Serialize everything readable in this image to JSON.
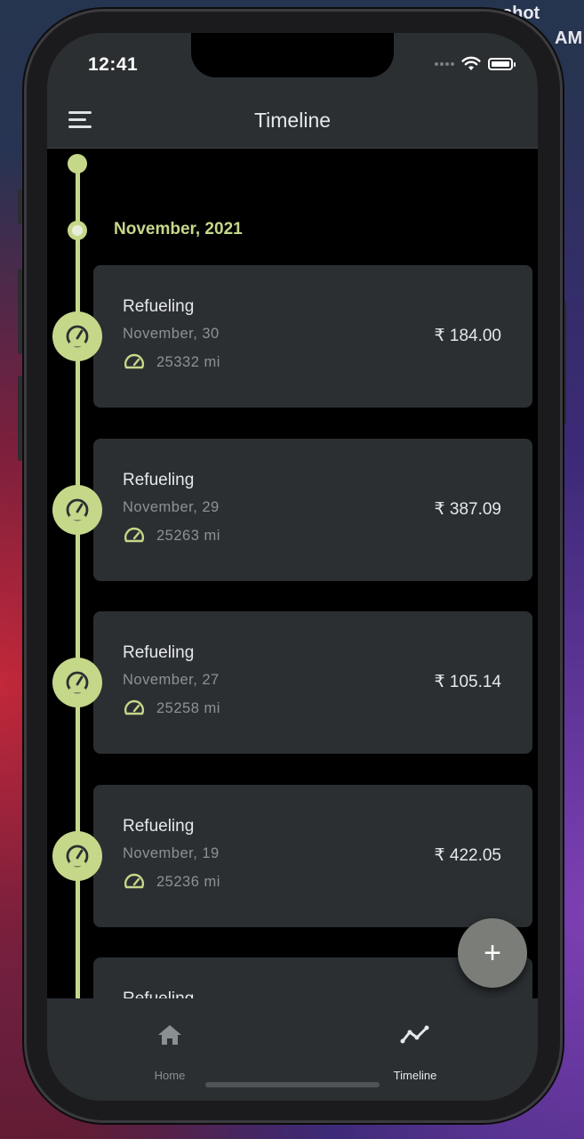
{
  "wallpaper_text": {
    "line1": "shot",
    "line2": "AM"
  },
  "status_bar": {
    "time": "12:41"
  },
  "app_bar": {
    "title": "Timeline"
  },
  "timeline": {
    "month_label": "November, 2021",
    "entries": [
      {
        "title": "Refueling",
        "date": "November, 30",
        "odometer": "25332 mi",
        "amount": "₹ 184.00"
      },
      {
        "title": "Refueling",
        "date": "November, 29",
        "odometer": "25263 mi",
        "amount": "₹ 387.09"
      },
      {
        "title": "Refueling",
        "date": "November, 27",
        "odometer": "25258 mi",
        "amount": "₹ 105.14"
      },
      {
        "title": "Refueling",
        "date": "November, 19",
        "odometer": "25236 mi",
        "amount": "₹ 422.05"
      },
      {
        "title": "Refueling"
      }
    ]
  },
  "fab": {
    "label": "+"
  },
  "bottom_nav": {
    "items": [
      {
        "label": "Home",
        "icon": "home-icon",
        "active": false
      },
      {
        "label": "Timeline",
        "icon": "timeline-chart-icon",
        "active": true
      }
    ]
  },
  "colors": {
    "accent": "#c5d88a",
    "surface": "#2b2f32",
    "background": "#000000",
    "text_primary": "#e6e8ea",
    "text_secondary": "#8d9296",
    "fab": "#7b7d78"
  }
}
